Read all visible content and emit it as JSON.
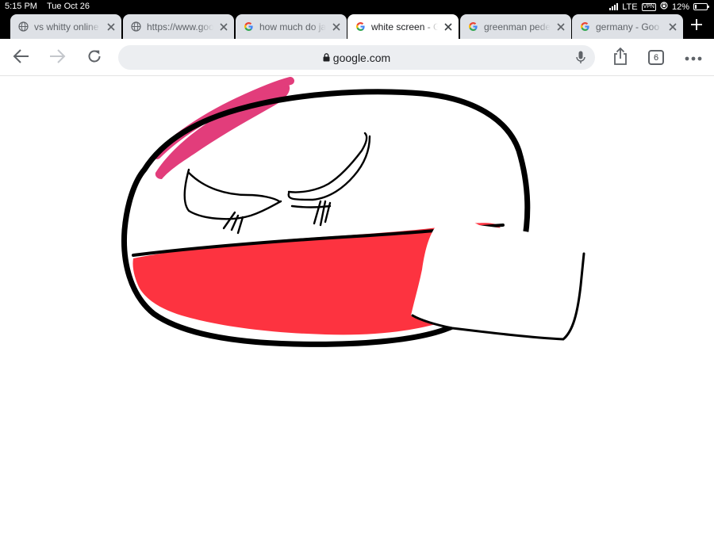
{
  "status_bar": {
    "time": "5:15 PM",
    "date": "Tue Oct 26",
    "network": "LTE",
    "vpn": "VPN",
    "battery": "12%",
    "battery_level": 0.12
  },
  "tabs": [
    {
      "title": "vs whitty online",
      "favicon": "globe-icon",
      "active": false
    },
    {
      "title": "https://www.google",
      "favicon": "globe-icon",
      "active": false
    },
    {
      "title": "how much do ja",
      "favicon": "google-g-icon",
      "active": false
    },
    {
      "title": "white screen - G",
      "favicon": "google-g-icon",
      "active": true
    },
    {
      "title": "greenman pede",
      "favicon": "google-g-icon",
      "active": false
    },
    {
      "title": "germany - Goo",
      "favicon": "google-g-icon",
      "active": false
    }
  ],
  "toolbar": {
    "url": "google.com",
    "tab_count": "6"
  },
  "colors": {
    "chrome_bg": "#000000",
    "tab_inactive": "#dee1e6",
    "tab_active": "#ffffff",
    "omnibox_bg": "#eceef1",
    "icon_gray": "#5f6368",
    "drawing_red": "#fd3340",
    "drawing_pink": "#e23d7b",
    "drawing_stroke": "#000000"
  }
}
